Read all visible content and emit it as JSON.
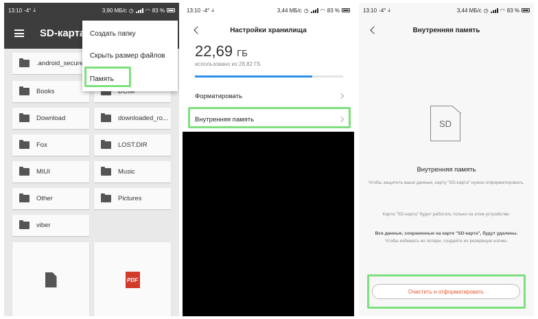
{
  "screen1": {
    "status": {
      "time": "13:10",
      "extra": "-4°",
      "speed": "3,90 МБ/с",
      "battery": "83 %"
    },
    "title": "SD-карта",
    "menu": [
      {
        "label": "Создать папку"
      },
      {
        "label": "Скрыть размер файлов"
      },
      {
        "label": "Память"
      }
    ],
    "folders": [
      ".android_secure",
      "",
      "Books",
      "DCIM",
      "Download",
      "downloaded_ro...",
      "Fox",
      "LOST.DIR",
      "MIUI",
      "Music",
      "Other",
      "Pictures",
      "viber"
    ],
    "pdf_label": "PDF",
    "highlight_color": "#7de07d"
  },
  "screen2": {
    "status": {
      "time": "13:10",
      "extra": "-4°",
      "speed": "3,44 МБ/с",
      "battery": "83 %"
    },
    "title": "Настройки хранилища",
    "size_value": "22,69",
    "size_unit": "ГБ",
    "used_text": "использовано из 28,82 ГБ",
    "used_fraction": 0.79,
    "rows": [
      "Форматировать",
      "Внутренняя память"
    ],
    "accent": "#2a8fe8"
  },
  "screen3": {
    "status": {
      "time": "13:10",
      "extra": "-4°",
      "speed": "3,44 МБ/с",
      "battery": "83 %"
    },
    "title": "Внутренняя память",
    "icon_text": "SD",
    "subtitle": "Внутренняя память",
    "para1": "Чтобы защитить ваши данные, карту \"SD-карта\" нужно отформатировать.",
    "para2": "Карта \"SD-карта\" будет работать только на этом устройстве.",
    "para3_bold": "Все данные, сохраненные на карте \"SD-карта\", будут удалены.",
    "para4": "Чтобы избежать их потери, создайте их резервную копию.",
    "button": "Очистить и отформатировать",
    "button_color": "#e5572c"
  }
}
